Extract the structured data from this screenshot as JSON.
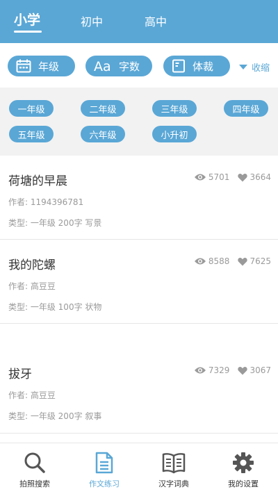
{
  "tabs": [
    {
      "label": "小学",
      "active": true
    },
    {
      "label": "初中",
      "active": false
    },
    {
      "label": "高中",
      "active": false
    }
  ],
  "filters": {
    "grade_label": "年级",
    "words_label": "字数",
    "genre_label": "体裁",
    "collapse_label": "收缩"
  },
  "grades": [
    "一年级",
    "二年级",
    "三年级",
    "四年级",
    "五年级",
    "六年级",
    "小升初"
  ],
  "essays": [
    {
      "title": "荷塘的早晨",
      "author": "作者: 1194396781",
      "meta": "类型: 一年级  200字    写景",
      "views": "5701",
      "likes": "3664"
    },
    {
      "title": "我的陀螺",
      "author": "作者: 高豆豆",
      "meta": "类型: 一年级  100字    状物",
      "views": "8588",
      "likes": "7625"
    },
    {
      "title": "拔牙",
      "author": "作者: 高豆豆",
      "meta": "类型: 一年级  200字    叙事",
      "views": "7329",
      "likes": "3067"
    }
  ],
  "bottom_nav": [
    {
      "label": "拍照搜索",
      "icon": "search-icon"
    },
    {
      "label": "作文练习",
      "icon": "document-icon"
    },
    {
      "label": "汉字词典",
      "icon": "book-icon"
    },
    {
      "label": "我的设置",
      "icon": "gear-icon"
    }
  ],
  "colors": {
    "accent": "#5aa7d6",
    "text": "#333333",
    "muted": "#9a9a9a",
    "panel": "#f2f2f2"
  }
}
